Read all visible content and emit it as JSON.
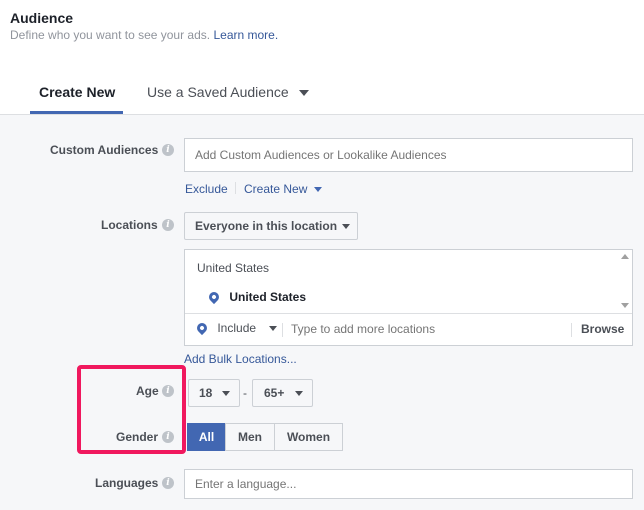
{
  "header": {
    "title": "Audience",
    "subtitle": "Define who you want to see your ads.",
    "learn_more": "Learn more."
  },
  "tabs": {
    "create_new": "Create New",
    "saved": "Use a Saved Audience"
  },
  "custom_audiences": {
    "label": "Custom Audiences",
    "placeholder": "Add Custom Audiences or Lookalike Audiences",
    "exclude": "Exclude",
    "create_new": "Create New"
  },
  "locations": {
    "label": "Locations",
    "dropdown": "Everyone in this location",
    "group_header": "United States",
    "selected": "United States",
    "include": "Include",
    "placeholder": "Type to add more locations",
    "browse": "Browse",
    "bulk": "Add Bulk Locations..."
  },
  "age": {
    "label": "Age",
    "min": "18",
    "dash": "-",
    "max": "65+"
  },
  "gender": {
    "label": "Gender",
    "options": [
      "All",
      "Men",
      "Women"
    ],
    "selected": "All"
  },
  "languages": {
    "label": "Languages",
    "placeholder": "Enter a language..."
  },
  "colors": {
    "accent": "#4267b2",
    "link": "#365899",
    "highlight": "#f0185e"
  }
}
